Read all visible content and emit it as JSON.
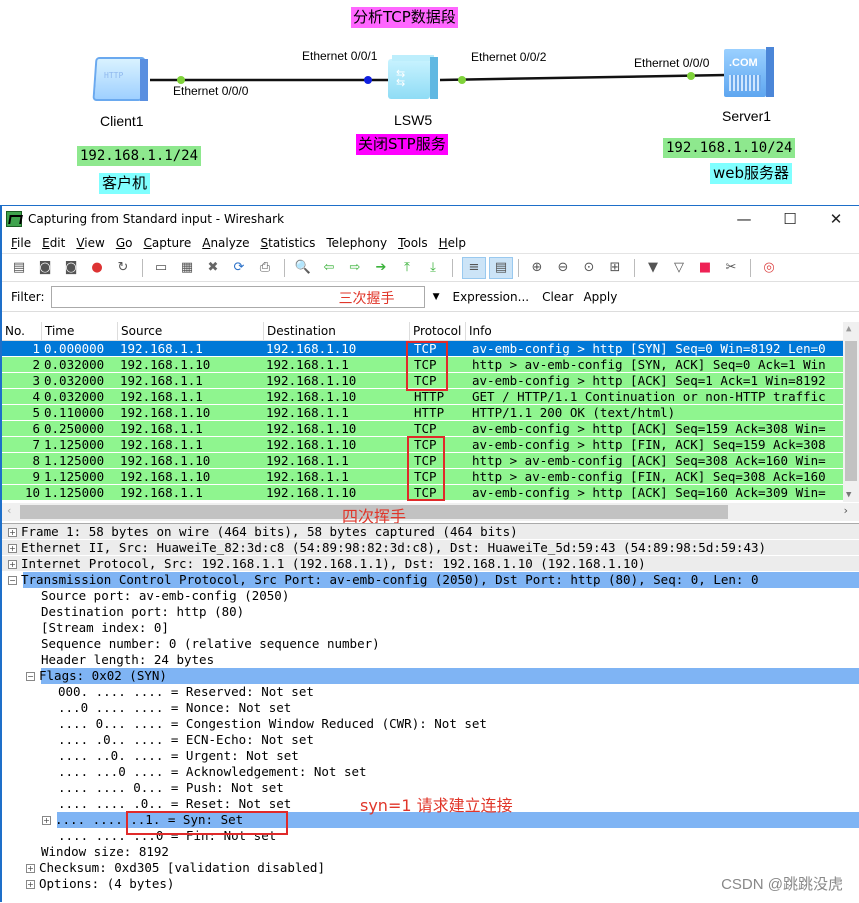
{
  "topology": {
    "title": "分析TCP数据段",
    "devices": {
      "client": {
        "name": "Client1",
        "ip": "192.168.1.1/24",
        "role": "客户机",
        "icon_text": "HTTP"
      },
      "switch": {
        "name": "LSW5",
        "note": "关闭STP服务"
      },
      "server": {
        "name": "Server1",
        "ip": "192.168.1.10/24",
        "role": "web服务器",
        "icon_text": ".COM"
      }
    },
    "ports": {
      "client_port": "Ethernet 0/0/0",
      "switch_port1": "Ethernet 0/0/1",
      "switch_port2": "Ethernet 0/0/2",
      "server_port": "Ethernet 0/0/0"
    }
  },
  "window": {
    "title": "Capturing from Standard input - Wireshark",
    "controls": {
      "minimize": "—",
      "maximize": "☐",
      "close": "✕"
    }
  },
  "menu": [
    {
      "label": "File",
      "mn": "F",
      "rest": "ile"
    },
    {
      "label": "Edit",
      "mn": "E",
      "rest": "dit"
    },
    {
      "label": "View",
      "mn": "V",
      "rest": "iew"
    },
    {
      "label": "Go",
      "mn": "G",
      "rest": "o"
    },
    {
      "label": "Capture",
      "mn": "C",
      "rest": "apture"
    },
    {
      "label": "Analyze",
      "mn": "A",
      "rest": "nalyze"
    },
    {
      "label": "Statistics",
      "mn": "S",
      "rest": "tatistics"
    },
    {
      "label": "Telephony",
      "mn": "",
      "rest": "Telephony"
    },
    {
      "label": "Tools",
      "mn": "T",
      "rest": "ools"
    },
    {
      "label": "Help",
      "mn": "H",
      "rest": "elp"
    }
  ],
  "toolbar": {
    "icons": [
      "interfaces-icon",
      "start-capture-icon",
      "stop-capture-icon",
      "options-capture-icon",
      "restart-capture-icon",
      "open-file-icon",
      "save-file-icon",
      "close-file-icon",
      "reload-icon",
      "print-icon",
      "find-packet-icon",
      "go-back-icon",
      "go-forward-icon",
      "go-to-packet-icon",
      "go-first-icon",
      "go-last-icon",
      "colorize-icon",
      "autoscroll-icon",
      "zoom-in-icon",
      "zoom-out-icon",
      "zoom-normal-icon",
      "resize-columns-icon",
      "capture-filters-icon",
      "display-filters-icon",
      "coloring-rules-icon",
      "preferences-icon",
      "help-icon"
    ]
  },
  "filter": {
    "label": "Filter:",
    "value": "",
    "expression_label": "Expression...",
    "clear_label": "Clear",
    "apply_label": "Apply"
  },
  "packet_list": {
    "columns": [
      "No.",
      "Time",
      "Source",
      "Destination",
      "Protocol",
      "Info"
    ],
    "rows": [
      {
        "no": "1",
        "time": "0.000000",
        "src": "192.168.1.1",
        "dst": "192.168.1.10",
        "proto": "TCP",
        "info": "av-emb-config > http [SYN] Seq=0 Win=8192 Len=0",
        "selected": true
      },
      {
        "no": "2",
        "time": "0.032000",
        "src": "192.168.1.10",
        "dst": "192.168.1.1",
        "proto": "TCP",
        "info": "http > av-emb-config [SYN, ACK] Seq=0 Ack=1 Win"
      },
      {
        "no": "3",
        "time": "0.032000",
        "src": "192.168.1.1",
        "dst": "192.168.1.10",
        "proto": "TCP",
        "info": "av-emb-config > http [ACK] Seq=1 Ack=1 Win=8192"
      },
      {
        "no": "4",
        "time": "0.032000",
        "src": "192.168.1.1",
        "dst": "192.168.1.10",
        "proto": "HTTP",
        "info": "GET / HTTP/1.1 Continuation or non-HTTP traffic"
      },
      {
        "no": "5",
        "time": "0.110000",
        "src": "192.168.1.10",
        "dst": "192.168.1.1",
        "proto": "HTTP",
        "info": "HTTP/1.1 200 OK  (text/html)"
      },
      {
        "no": "6",
        "time": "0.250000",
        "src": "192.168.1.1",
        "dst": "192.168.1.10",
        "proto": "TCP",
        "info": "av-emb-config > http [ACK] Seq=159 Ack=308 Win="
      },
      {
        "no": "7",
        "time": "1.125000",
        "src": "192.168.1.1",
        "dst": "192.168.1.10",
        "proto": "TCP",
        "info": "av-emb-config > http [FIN, ACK] Seq=159 Ack=308"
      },
      {
        "no": "8",
        "time": "1.125000",
        "src": "192.168.1.10",
        "dst": "192.168.1.1",
        "proto": "TCP",
        "info": "http > av-emb-config [ACK] Seq=308 Ack=160 Win="
      },
      {
        "no": "9",
        "time": "1.125000",
        "src": "192.168.1.10",
        "dst": "192.168.1.1",
        "proto": "TCP",
        "info": "http > av-emb-config [FIN, ACK] Seq=308 Ack=160"
      },
      {
        "no": "10",
        "time": "1.125000",
        "src": "192.168.1.1",
        "dst": "192.168.1.10",
        "proto": "TCP",
        "info": "av-emb-config > http [ACK] Seq=160 Ack=309 Win="
      }
    ]
  },
  "details": [
    {
      "text": "Frame 1: 58 bytes on wire (464 bits), 58 bytes captured (464 bits)",
      "level": 0,
      "expander": "+",
      "style": "gray"
    },
    {
      "text": "Ethernet II, Src: HuaweiTe_82:3d:c8 (54:89:98:82:3d:c8), Dst: HuaweiTe_5d:59:43 (54:89:98:5d:59:43)",
      "level": 0,
      "expander": "+",
      "style": "gray"
    },
    {
      "text": "Internet Protocol, Src: 192.168.1.1 (192.168.1.1), Dst: 192.168.1.10 (192.168.1.10)",
      "level": 0,
      "expander": "+",
      "style": "gray"
    },
    {
      "text": "Transmission Control Protocol, Src Port: av-emb-config (2050), Dst Port: http (80), Seq: 0, Len: 0",
      "level": 0,
      "expander": "-",
      "style": "hl"
    },
    {
      "text": "Source port: av-emb-config (2050)",
      "level": 1
    },
    {
      "text": "Destination port: http (80)",
      "level": 1
    },
    {
      "text": "[Stream index: 0]",
      "level": 1
    },
    {
      "text": "Sequence number: 0    (relative sequence number)",
      "level": 1
    },
    {
      "text": "Header length: 24 bytes",
      "level": 1
    },
    {
      "text": "Flags: 0x02 (SYN)",
      "level": 1,
      "expander": "-",
      "style": "hl"
    },
    {
      "text": "000. .... .... = Reserved: Not set",
      "level": 2
    },
    {
      "text": "...0 .... .... = Nonce: Not set",
      "level": 2
    },
    {
      "text": ".... 0... .... = Congestion Window Reduced (CWR): Not set",
      "level": 2
    },
    {
      "text": ".... .0.. .... = ECN-Echo: Not set",
      "level": 2
    },
    {
      "text": ".... ..0. .... = Urgent: Not set",
      "level": 2
    },
    {
      "text": ".... ...0 .... = Acknowledgement: Not set",
      "level": 2
    },
    {
      "text": ".... .... 0... = Push: Not set",
      "level": 2
    },
    {
      "text": ".... .... .0.. = Reset: Not set",
      "level": 2
    },
    {
      "text": ".... .... ..1. = Syn: Set",
      "level": 2,
      "expander": "+",
      "style": "hl"
    },
    {
      "text": ".... .... ...0 = Fin: Not set",
      "level": 2
    },
    {
      "text": "Window size: 8192",
      "level": 1
    },
    {
      "text": "Checksum: 0xd305 [validation disabled]",
      "level": 1,
      "expander": "+"
    },
    {
      "text": "Options: (4 bytes)",
      "level": 1,
      "expander": "+"
    }
  ],
  "annotations": {
    "three_way": "三次握手",
    "four_way": "四次挥手",
    "syn_note": "syn=1  请求建立连接"
  },
  "watermark": "CSDN @跳跳没虎",
  "colors": {
    "selected_row": "#0078d7",
    "tcp_row": "#8ff58f",
    "highlight": "#7fb4f4",
    "annotation_red": "#e0362a"
  }
}
